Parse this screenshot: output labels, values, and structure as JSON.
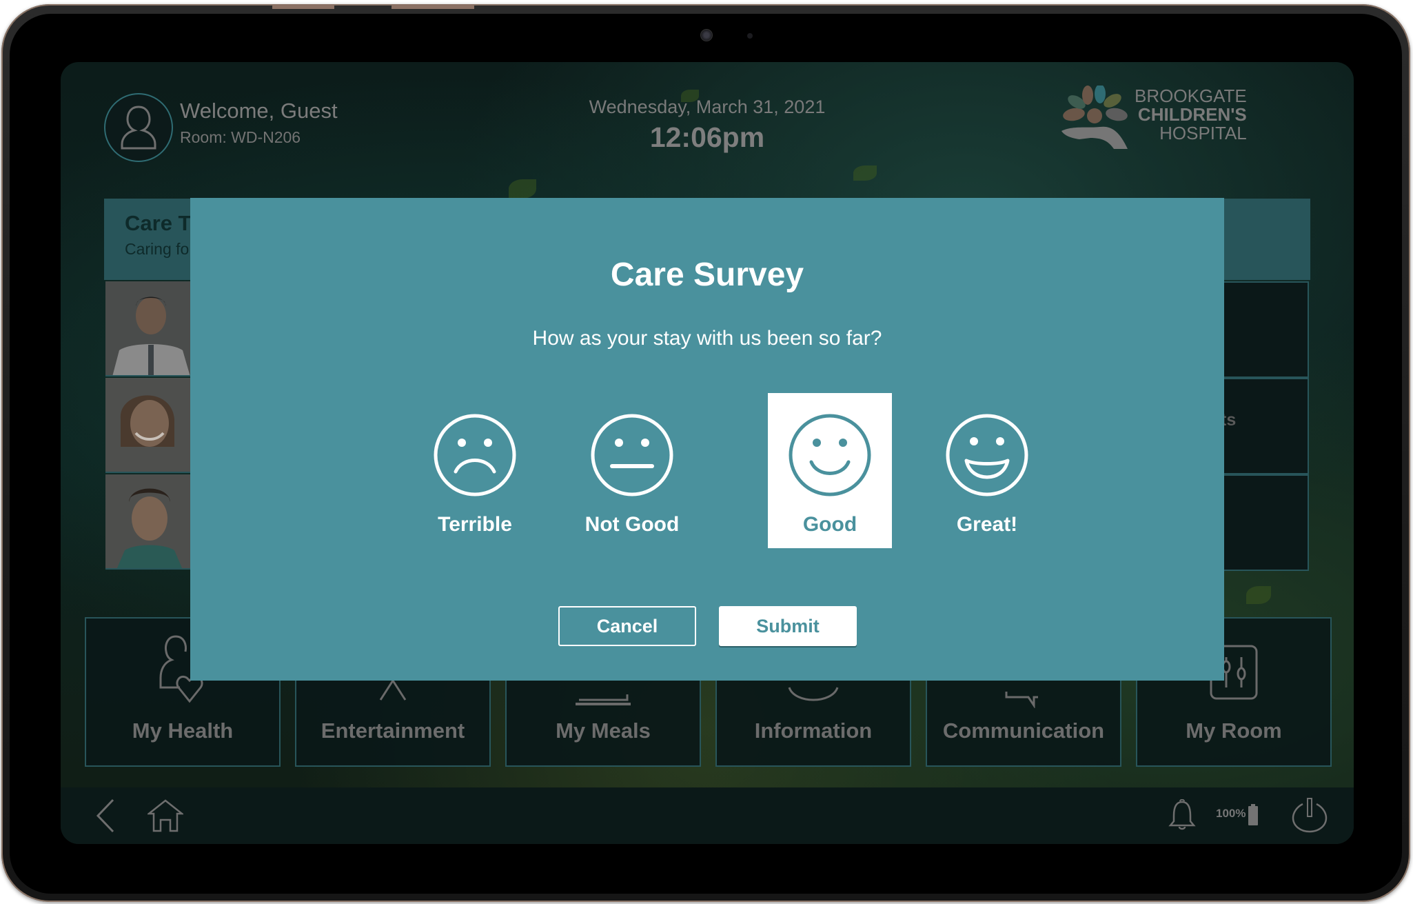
{
  "header": {
    "welcome": "Welcome, Guest",
    "room": "Room: WD-N206",
    "date": "Wednesday, March 31, 2021",
    "time": "12:06pm",
    "logo": {
      "line1": "BROOKGATE",
      "line2": "CHILDREN'S",
      "line3": "HOSPITAL"
    }
  },
  "care_team": {
    "title": "Care T",
    "subtitle": "Caring fo",
    "photos": [
      "doctor-male-glasses",
      "nurse-female-short-hair",
      "nurse-female-scrubs"
    ],
    "right_cells": [
      "",
      "ts",
      ""
    ]
  },
  "tiles": [
    {
      "label": "My Health",
      "icon": "person-heart-icon"
    },
    {
      "label": "Entertainment",
      "icon": "tv-antenna-icon"
    },
    {
      "label": "My Meals",
      "icon": "meal-tray-icon"
    },
    {
      "label": "Information",
      "icon": "info-circle-icon"
    },
    {
      "label": "Communication",
      "icon": "chat-bubble-icon"
    },
    {
      "label": "My Room",
      "icon": "room-controls-icon"
    }
  ],
  "navbar": {
    "back": "back-icon",
    "home": "home-icon",
    "notifications": "bell-icon",
    "battery_text": "100%",
    "battery_level": 1.0,
    "power": "power-icon"
  },
  "modal": {
    "title": "Care Survey",
    "question": "How as your stay with us been so far?",
    "options": [
      {
        "label": "Terrible",
        "icon": "sad-face-icon",
        "selected": false
      },
      {
        "label": "Not Good",
        "icon": "neutral-face-icon",
        "selected": false
      },
      {
        "label": "Good",
        "icon": "smile-face-icon",
        "selected": true
      },
      {
        "label": "Great!",
        "icon": "grin-face-icon",
        "selected": false
      }
    ],
    "cancel_label": "Cancel",
    "submit_label": "Submit"
  },
  "colors": {
    "modal_bg": "#4a919d",
    "accent": "#28555a",
    "text_dim": "#7a7a7a",
    "selected_bg": "#ffffff"
  }
}
